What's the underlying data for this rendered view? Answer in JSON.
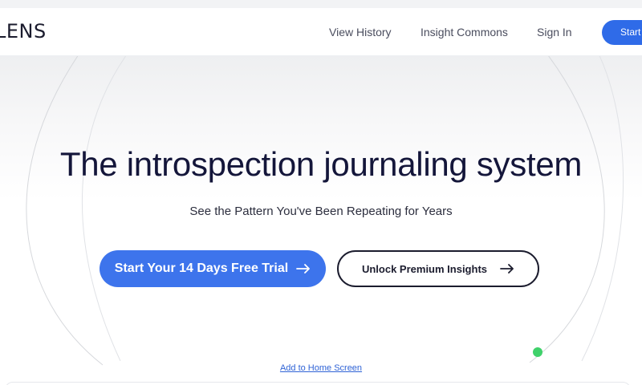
{
  "brand": {
    "logo_text": "LENS"
  },
  "nav": {
    "links": [
      {
        "label": "View History"
      },
      {
        "label": "Insight Commons"
      },
      {
        "label": "Sign In"
      }
    ],
    "start_label": "Start"
  },
  "hero": {
    "headline": "The introspection journaling system",
    "subheadline": "See the Pattern You've Been Repeating for Years",
    "primary_cta": {
      "label": "Start Your 14 Days Free Trial",
      "icon": "arrow-right-icon"
    },
    "secondary_cta": {
      "label": "Unlock Premium Insights",
      "icon": "arrow-right-icon"
    },
    "add_to_home_label": "Add to Home Screen"
  },
  "colors": {
    "primary": "#3d74ec",
    "nav_button": "#2f6be8",
    "text_dark": "#14163a",
    "link": "#2f63d6",
    "status_dot": "#3fd16a"
  }
}
